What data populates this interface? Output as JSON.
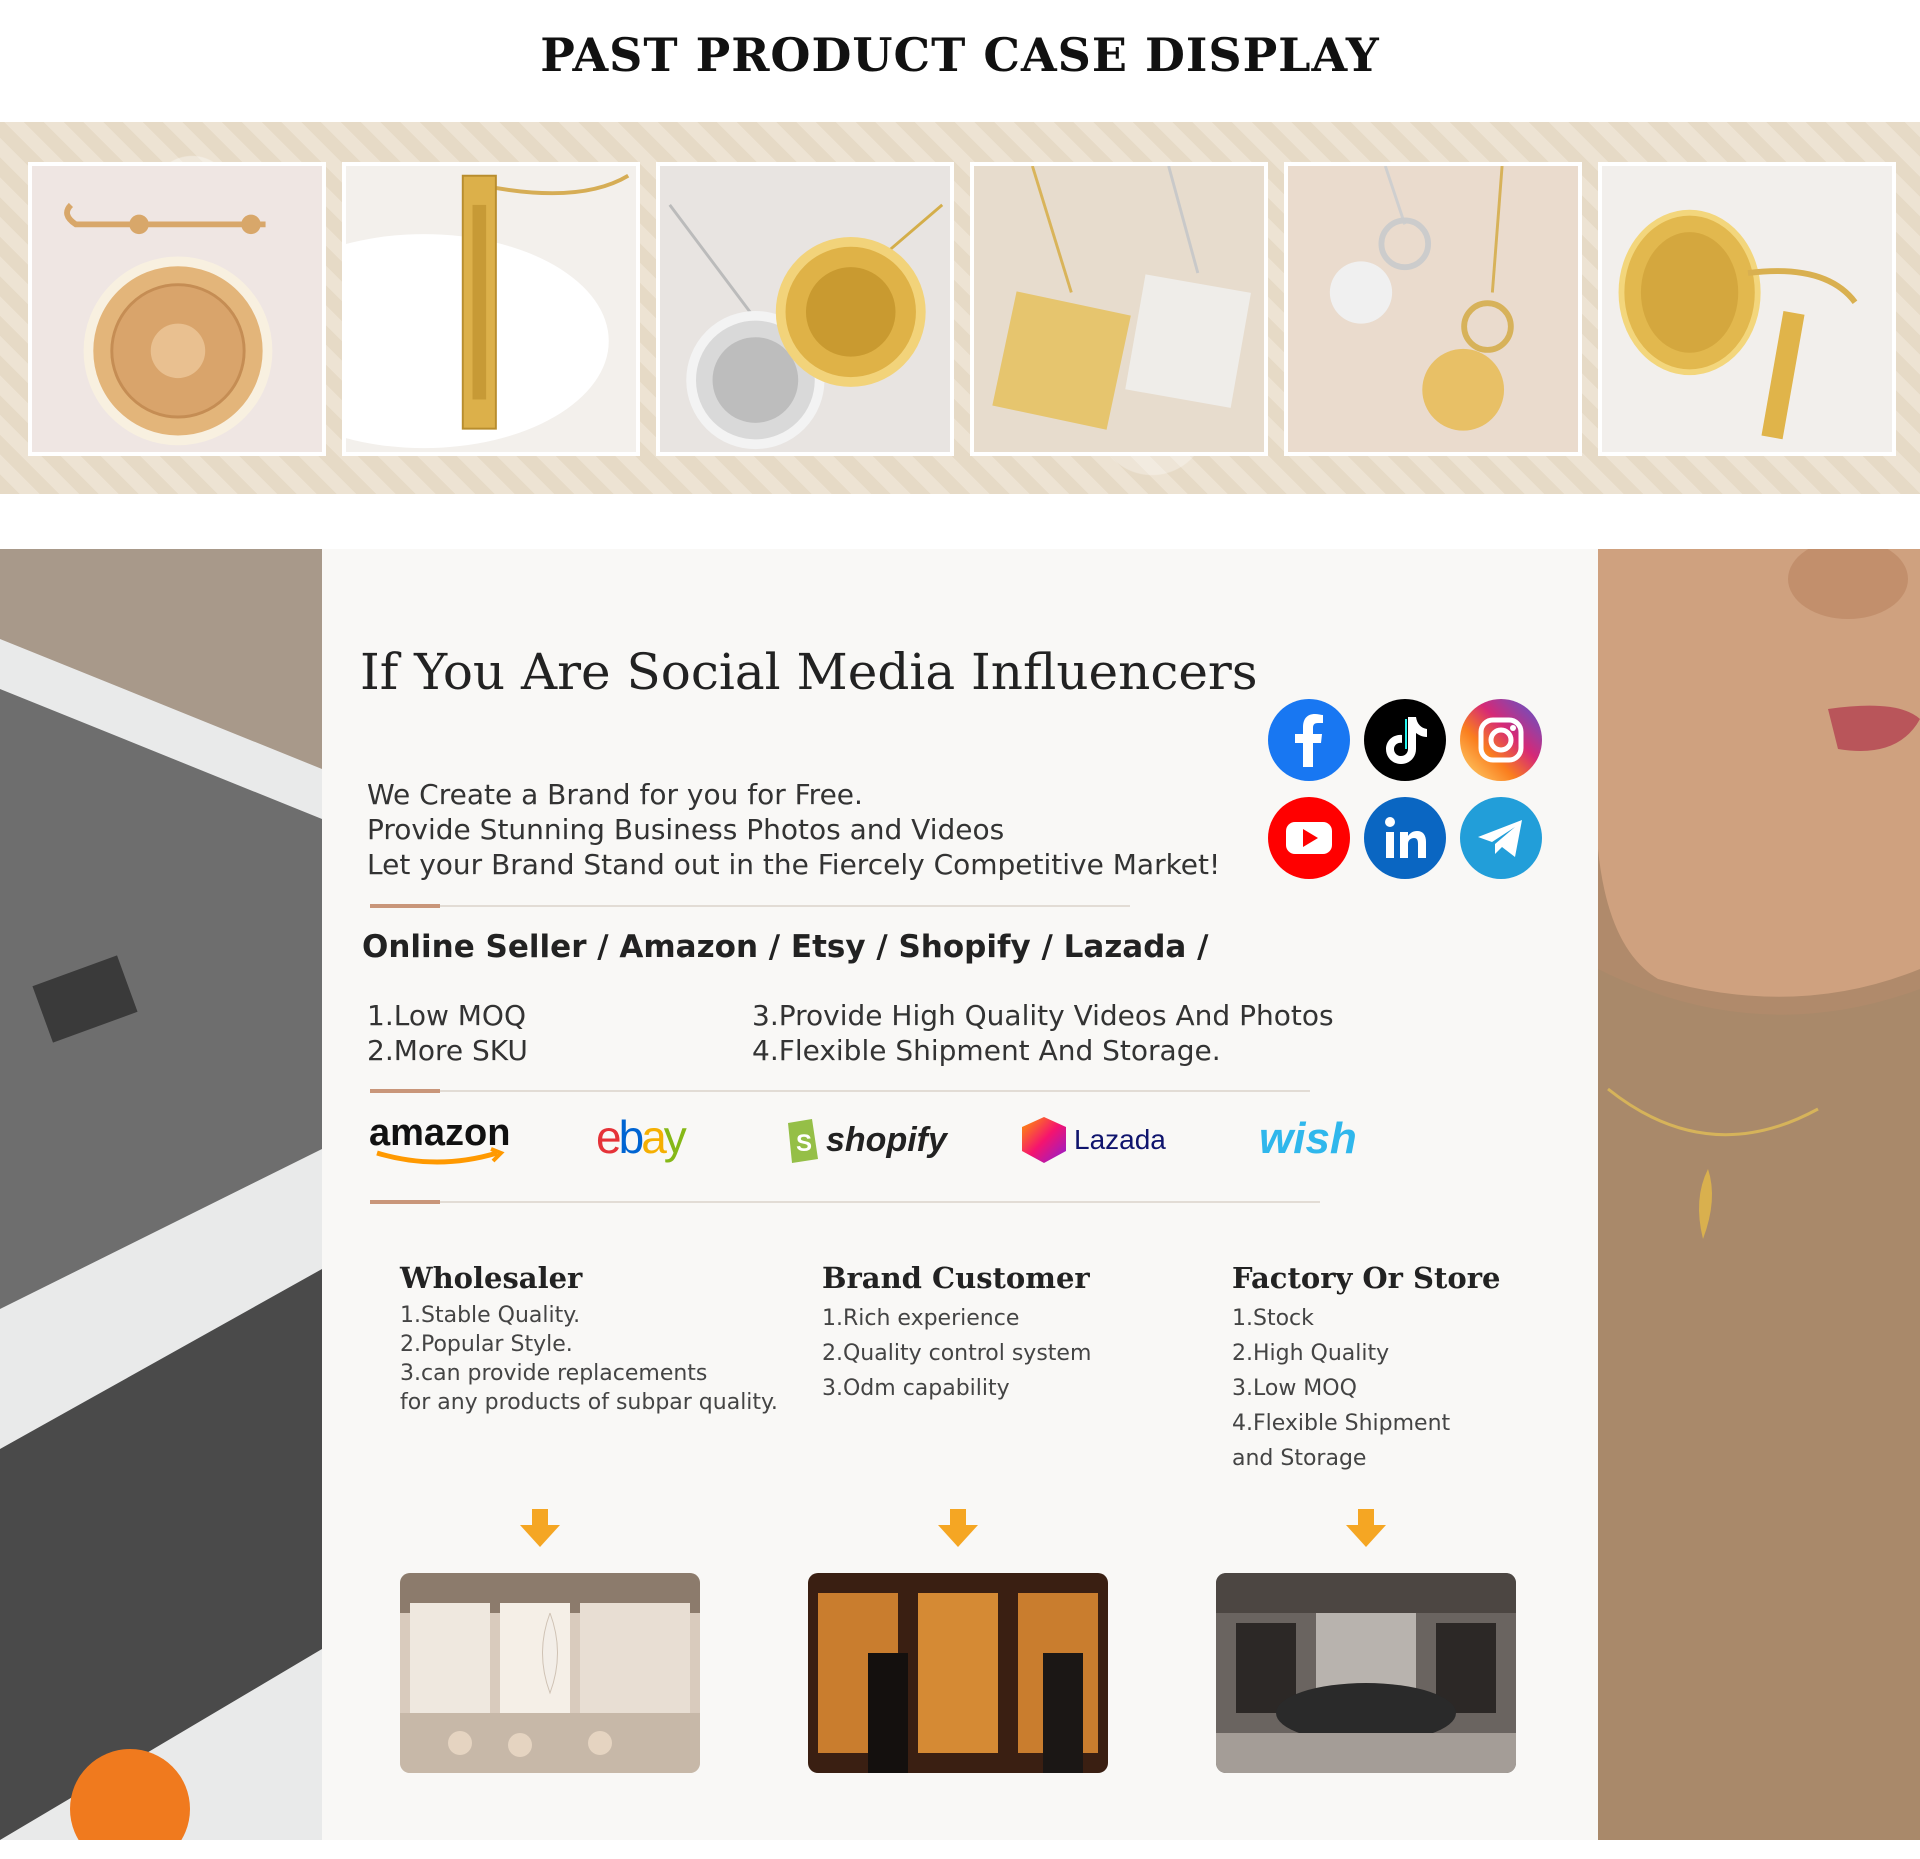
{
  "header": {
    "title": "PAST PRODUCT CASE DISPLAY"
  },
  "gallery": {
    "items": [
      {
        "name": "safety-pin-pendant-photo"
      },
      {
        "name": "bar-necklace-photo"
      },
      {
        "name": "locket-necklaces-photo"
      },
      {
        "name": "notebook-pendants-photo"
      },
      {
        "name": "toggle-necklaces-photo"
      },
      {
        "name": "ring-and-bar-photo"
      }
    ]
  },
  "panel": {
    "title": "If You Are Social Media Influencers",
    "intro_lines": [
      "We Create a Brand for you for Free.",
      "Provide Stunning Business Photos and Videos",
      "Let your Brand Stand out in the Fiercely Competitive Market!"
    ],
    "online_seller": "Online Seller / Amazon / Etsy / Shopify / Lazada /",
    "features": [
      "1.Low MOQ",
      "2.More SKU",
      "3.Provide High Quality Videos And Photos",
      "4.Flexible Shipment And Storage."
    ],
    "social_icons": [
      "facebook-icon",
      "tiktok-icon",
      "instagram-icon",
      "youtube-icon",
      "linkedin-icon",
      "telegram-icon"
    ],
    "platforms": [
      "amazon",
      "ebay",
      "shopify",
      "Lazada",
      "wish"
    ],
    "columns": [
      {
        "title": "Wholesaler",
        "items": [
          "1.Stable Quality.",
          "2.Popular Style.",
          "3.can provide replacements",
          "for any products of subpar quality."
        ]
      },
      {
        "title": "Brand Customer",
        "items": [
          "1.Rich experience",
          "2.Quality control system",
          "3.Odm capability"
        ]
      },
      {
        "title": "Factory Or Store",
        "items": [
          "1.Stock",
          "2.High Quality",
          "3.Low MOQ",
          "4.Flexible Shipment",
          "and Storage"
        ]
      }
    ]
  },
  "colors": {
    "accent": "#c9967a",
    "arrow": "#f5a623",
    "amazon_orange": "#ff9900",
    "facebook": "#1877f2",
    "youtube": "#ff0000",
    "linkedin": "#0a66c2",
    "telegram": "#229ed9"
  }
}
